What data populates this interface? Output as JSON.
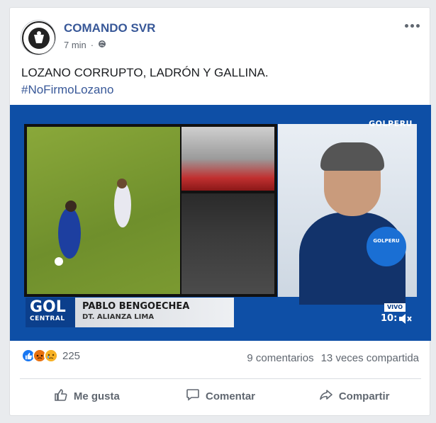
{
  "post": {
    "page_name": "COMANDO SVR",
    "time": "7 min",
    "privacy_icon": "globe-icon",
    "text_line1": "LOZANO CORRUPTO, LADRÓN Y GALLINA.",
    "hashtag": "#NoFirmoLozano"
  },
  "video": {
    "brand": "GOLPERU",
    "gol": "GOL",
    "gol_sub": "CENTRAL",
    "name": "PABLO BENGOECHEA",
    "role": "DT. ALIANZA LIMA",
    "live": "VIVO",
    "clock": "10:",
    "mic_label": "GOLPERU",
    "mute_icon": "speaker-muted-icon"
  },
  "stats": {
    "reaction_icons": [
      "like-icon",
      "angry-icon",
      "sad-icon"
    ],
    "reaction_count": "225",
    "comments": "9 comentarios",
    "shares": "13 veces compartida"
  },
  "actions": {
    "like": "Me gusta",
    "comment": "Comentar",
    "share": "Compartir"
  },
  "colors": {
    "accent": "#385898",
    "like_blue": "#1877f2",
    "video_blue": "#0e4fa6"
  }
}
